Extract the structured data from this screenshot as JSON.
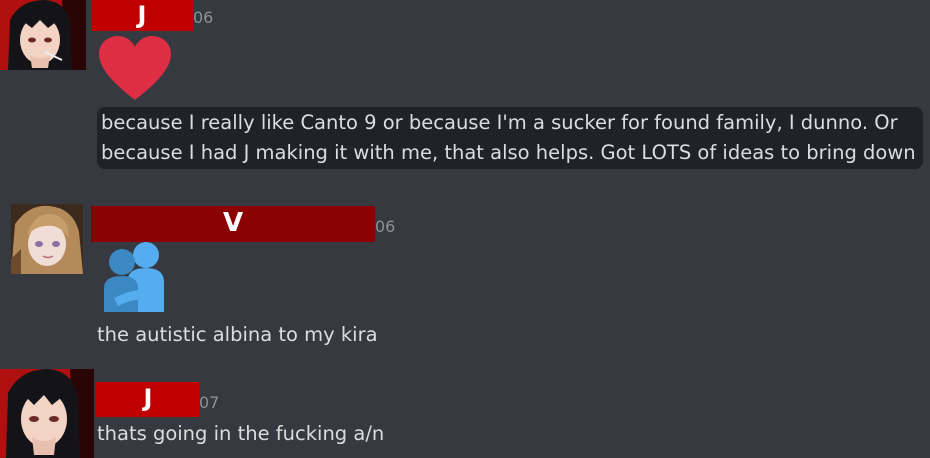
{
  "messages": [
    {
      "author_mark": "J",
      "timestamp_tail": "06",
      "reaction_emoji": "heart-emoji",
      "text_lines": [
        "because I really like Canto 9 or because I'm a sucker for found family, I dunno. Or",
        "because I had J making it with me, that also helps. Got LOTS of ideas to bring down"
      ]
    },
    {
      "author_mark": "V",
      "timestamp_tail": "06",
      "reaction_emoji": "people-hugging-emoji",
      "text": "the autistic albina to my kira"
    },
    {
      "author_mark": "J",
      "timestamp_tail": "07",
      "text": "thats going in the fucking a/n"
    }
  ],
  "colors": {
    "background": "#36393f",
    "redaction_red": "#c00000",
    "redaction_dark_red": "#8b0000",
    "heart": "#dd2e44",
    "hug_figure_back": "#3b88c3",
    "hug_figure_front": "#55acee"
  }
}
